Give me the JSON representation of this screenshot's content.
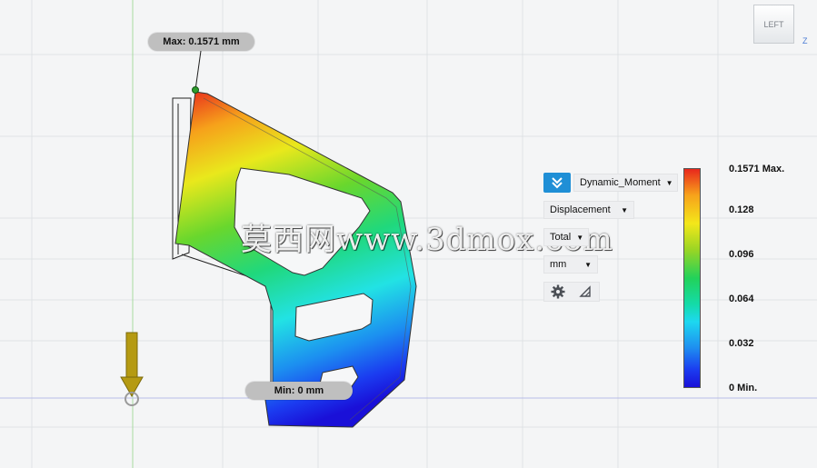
{
  "annotations": {
    "max_label": "Max: 0.1571 mm",
    "min_label": "Min: 0 mm"
  },
  "result_panel": {
    "result_dropdown": "Dynamic_Moment",
    "type_dropdown": "Displacement",
    "component_dropdown": "Total",
    "unit_dropdown": "mm"
  },
  "legend": {
    "labels": [
      "0.1571 Max.",
      "0.128",
      "0.096",
      "0.064",
      "0.032",
      "0 Min."
    ],
    "max_color": "#e8271c",
    "min_color": "#1a10d8"
  },
  "viewcube": {
    "face_label": "LEFT",
    "axis_label": "Z"
  },
  "watermark": "莫西网www.3dmox.com",
  "icons": {
    "result_toggle": "double-chevron-down-icon",
    "settings": "gear-icon",
    "probe": "probe-triangle-icon",
    "load_arrow": "load-arrow-icon"
  },
  "colors": {
    "accent": "#1f8fd6",
    "load_arrow": "#b59a12"
  }
}
